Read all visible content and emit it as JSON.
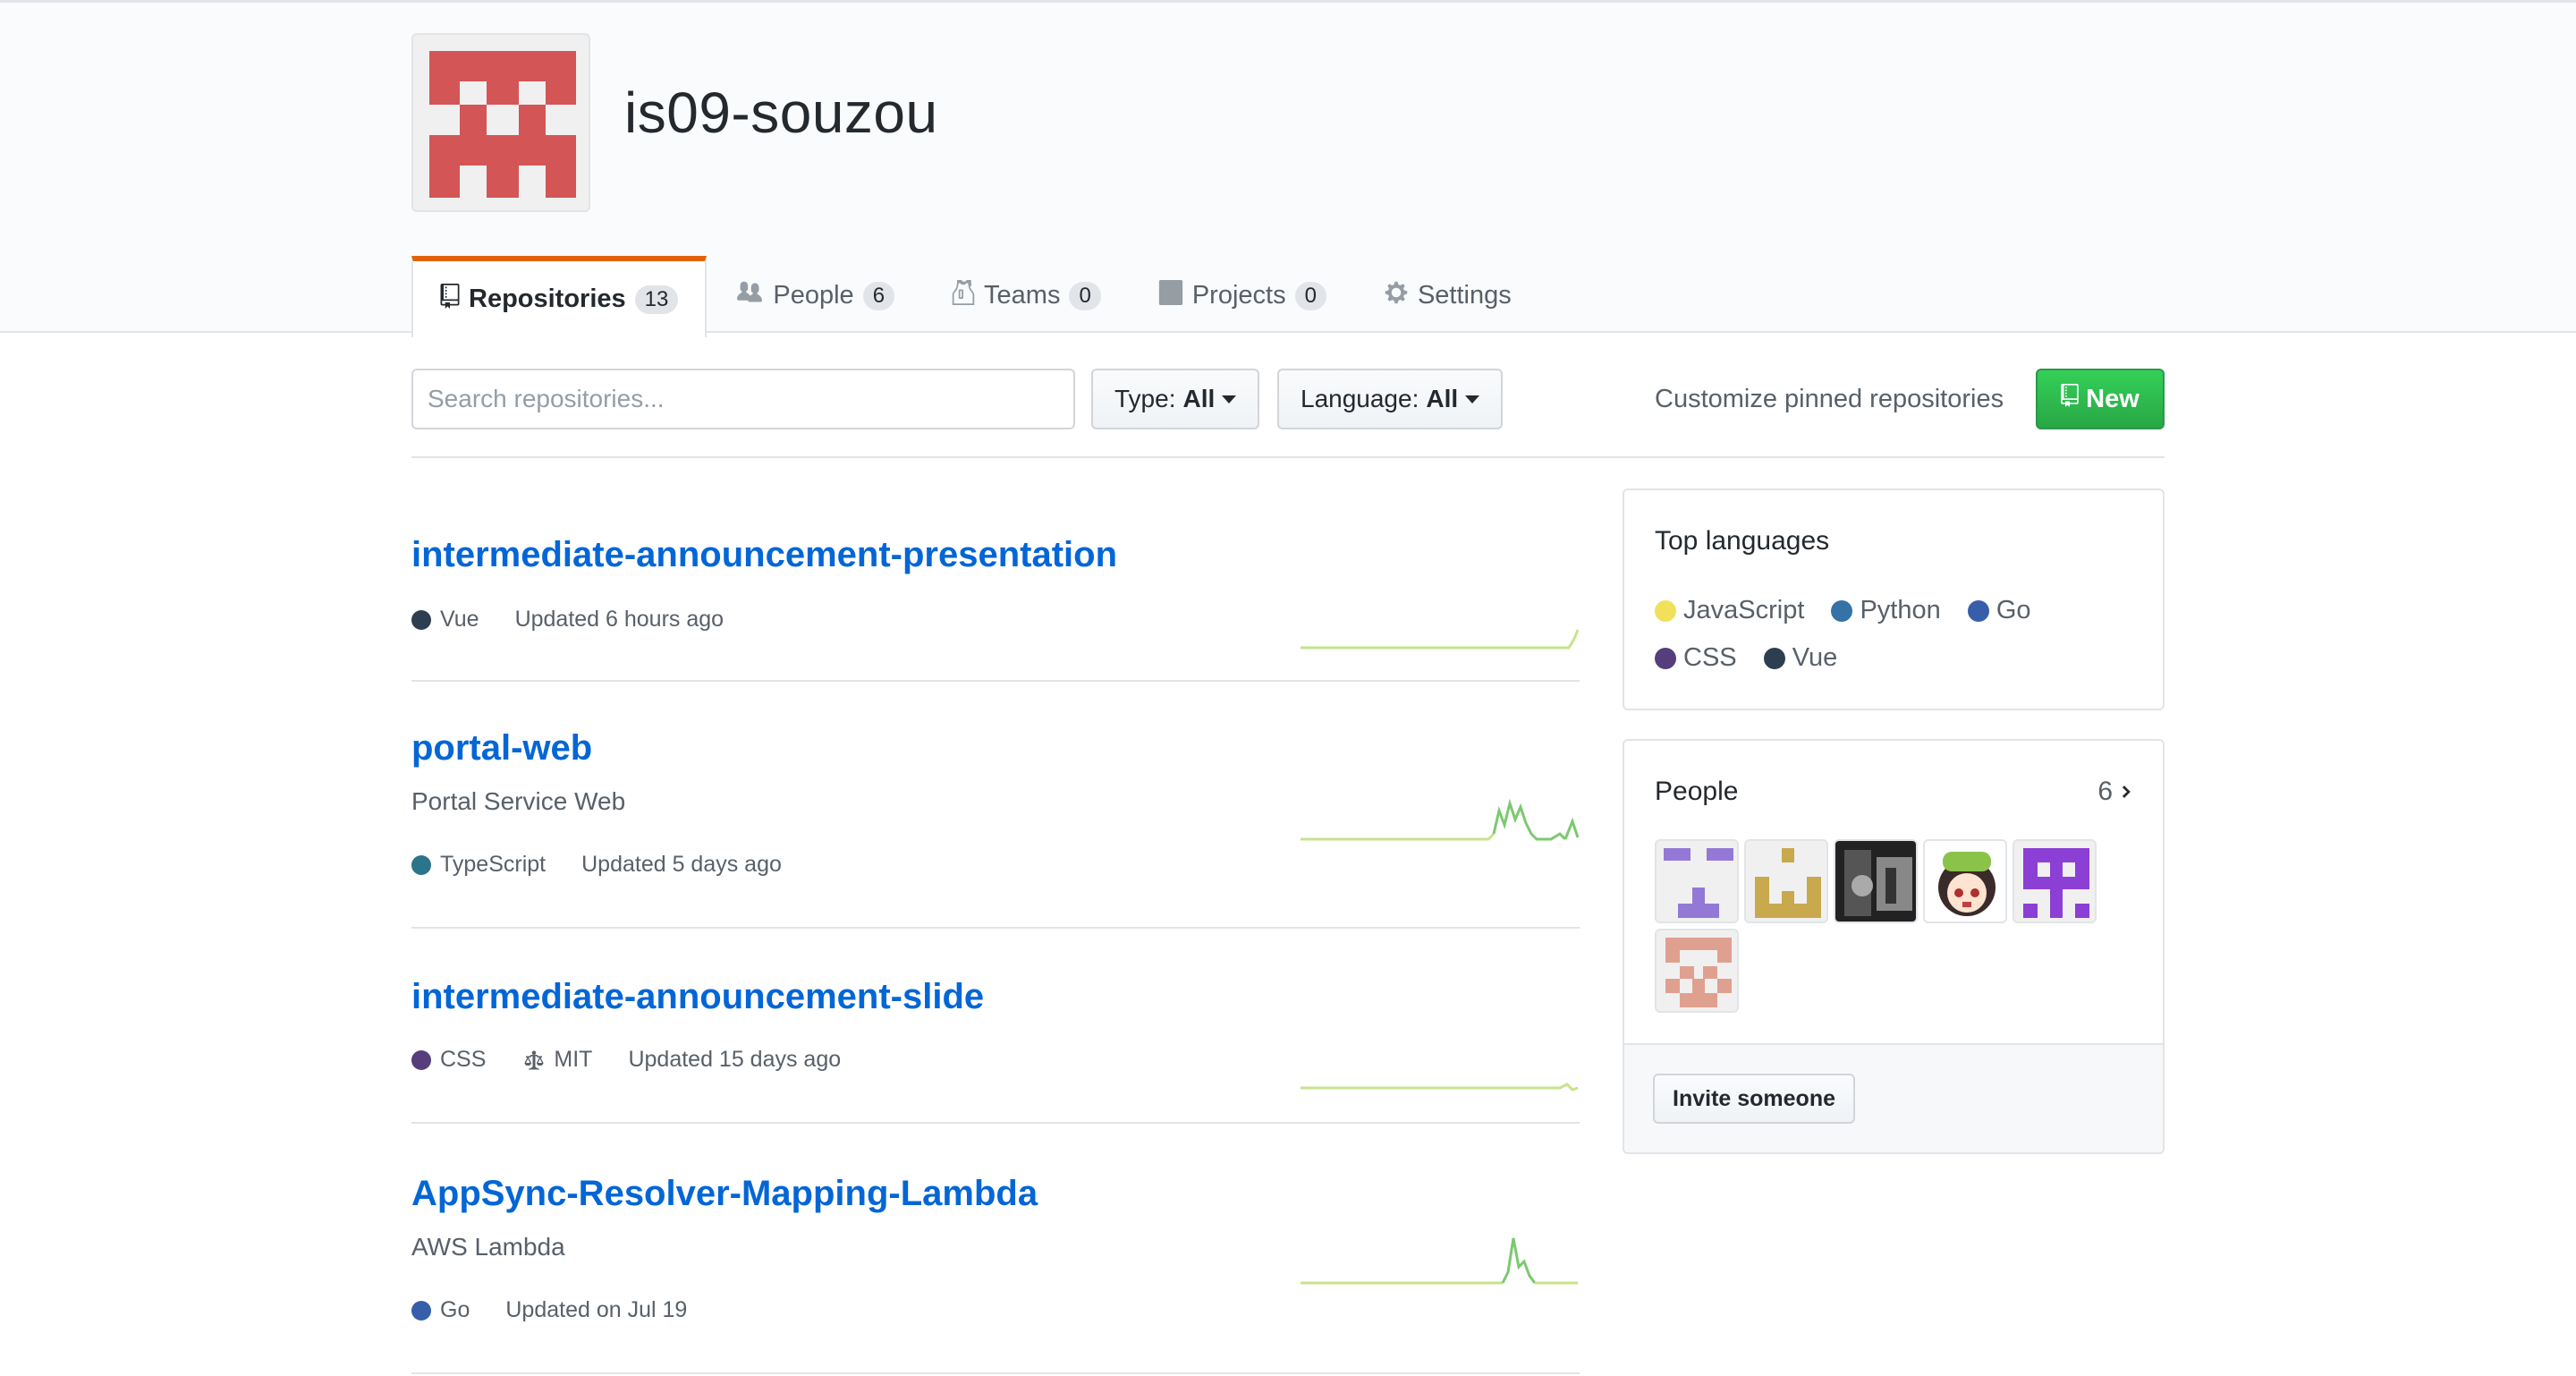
{
  "org": {
    "name": "is09-souzou",
    "avatar_color": "#d35555"
  },
  "tabs": [
    {
      "label": "Repositories",
      "count": "13"
    },
    {
      "label": "People",
      "count": "6"
    },
    {
      "label": "Teams",
      "count": "0"
    },
    {
      "label": "Projects",
      "count": "0"
    },
    {
      "label": "Settings"
    }
  ],
  "filters": {
    "search_placeholder": "Search repositories...",
    "type_label": "Type:",
    "type_value": "All",
    "language_label": "Language:",
    "language_value": "All",
    "customize_link": "Customize pinned repositories",
    "new_button": "New"
  },
  "repos": [
    {
      "name": "intermediate-announcement-presentation",
      "description": "",
      "language": "Vue",
      "language_color": "#2c3e50",
      "license": "",
      "updated": "Updated 6 hours ago"
    },
    {
      "name": "portal-web",
      "description": "Portal Service Web",
      "language": "TypeScript",
      "language_color": "#2b7489",
      "license": "",
      "updated": "Updated 5 days ago"
    },
    {
      "name": "intermediate-announcement-slide",
      "description": "",
      "language": "CSS",
      "language_color": "#563d7c",
      "license": "MIT",
      "updated": "Updated 15 days ago"
    },
    {
      "name": "AppSync-Resolver-Mapping-Lambda",
      "description": "AWS Lambda",
      "language": "Go",
      "language_color": "#375eab",
      "license": "",
      "updated": "Updated on Jul 19"
    }
  ],
  "top_languages": {
    "title": "Top languages",
    "items": [
      {
        "name": "JavaScript",
        "color": "#f1e05a"
      },
      {
        "name": "Python",
        "color": "#3572A5"
      },
      {
        "name": "Go",
        "color": "#375eab"
      },
      {
        "name": "CSS",
        "color": "#563d7c"
      },
      {
        "name": "Vue",
        "color": "#2c3e50"
      }
    ]
  },
  "people": {
    "title": "People",
    "count": "6",
    "invite_button": "Invite someone"
  }
}
